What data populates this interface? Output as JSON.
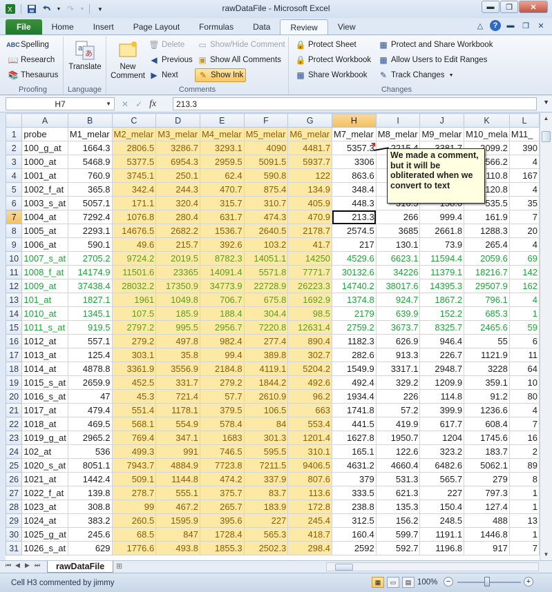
{
  "window": {
    "title": "rawDataFile - Microsoft Excel",
    "controls": [
      "minimize",
      "restore",
      "close"
    ]
  },
  "ribbon": {
    "tabs": [
      "File",
      "Home",
      "Insert",
      "Page Layout",
      "Formulas",
      "Data",
      "Review",
      "View"
    ],
    "active_tab": "Review",
    "groups": {
      "proofing": {
        "label": "Proofing",
        "spelling": "Spelling",
        "research": "Research",
        "thesaurus": "Thesaurus"
      },
      "language": {
        "label": "Language",
        "translate": "Translate"
      },
      "comments": {
        "label": "Comments",
        "new_comment": "New\nComment",
        "delete": "Delete",
        "previous": "Previous",
        "next": "Next",
        "show_hide": "Show/Hide Comment",
        "show_all": "Show All Comments",
        "show_ink": "Show Ink"
      },
      "changes": {
        "label": "Changes",
        "protect_sheet": "Protect Sheet",
        "protect_workbook": "Protect Workbook",
        "share_workbook": "Share Workbook",
        "protect_share": "Protect and Share Workbook",
        "allow_edit": "Allow Users to Edit Ranges",
        "track_changes": "Track Changes"
      }
    }
  },
  "formula_bar": {
    "name_box": "H7",
    "formula": "213.3"
  },
  "grid": {
    "columns": [
      "A",
      "B",
      "C",
      "D",
      "E",
      "F",
      "G",
      "H",
      "I",
      "J",
      "K",
      "L"
    ],
    "selected_column": "H",
    "selected_row": "7",
    "header_row": [
      "probe",
      "M1_melar",
      "M2_melar",
      "M3_melar",
      "M4_melar",
      "M5_melar",
      "M6_melar",
      "M7_melar",
      "M8_melar",
      "M9_melar",
      "M10_mela",
      "M11_"
    ],
    "rows": [
      {
        "n": "2",
        "c": [
          "100_g_at",
          "1664.3",
          "2806.5",
          "3286.7",
          "3293.1",
          "4090",
          "4481.7",
          "5357.3",
          "2215.4",
          "3381.7",
          "2099.2",
          "390"
        ]
      },
      {
        "n": "3",
        "c": [
          "1000_at",
          "5468.9",
          "5377.5",
          "6954.3",
          "2959.5",
          "5091.5",
          "5937.7",
          "3306",
          "",
          "",
          "566.2",
          "4"
        ]
      },
      {
        "n": "4",
        "c": [
          "1001_at",
          "760.9",
          "3745.1",
          "250.1",
          "62.4",
          "590.8",
          "122",
          "863.6",
          "",
          "",
          "110.8",
          "167"
        ]
      },
      {
        "n": "5",
        "c": [
          "1002_f_at",
          "365.8",
          "342.4",
          "244.3",
          "470.7",
          "875.4",
          "134.9",
          "348.4",
          "",
          "",
          "120.8",
          "4"
        ]
      },
      {
        "n": "6",
        "c": [
          "1003_s_at",
          "5057.1",
          "171.1",
          "320.4",
          "315.7",
          "310.7",
          "405.9",
          "448.3",
          "316.5",
          "158.0",
          "535.5",
          "35"
        ]
      },
      {
        "n": "7",
        "c": [
          "1004_at",
          "7292.4",
          "1076.8",
          "280.4",
          "631.7",
          "474.3",
          "470.9",
          "213.3",
          "266",
          "999.4",
          "161.9",
          "7"
        ]
      },
      {
        "n": "8",
        "c": [
          "1005_at",
          "2293.1",
          "14676.5",
          "2682.2",
          "1536.7",
          "2640.5",
          "2178.7",
          "2574.5",
          "3685",
          "2661.8",
          "1288.3",
          "20"
        ]
      },
      {
        "n": "9",
        "c": [
          "1006_at",
          "590.1",
          "49.6",
          "215.7",
          "392.6",
          "103.2",
          "41.7",
          "217",
          "130.1",
          "73.9",
          "265.4",
          "4"
        ]
      },
      {
        "n": "10",
        "g": true,
        "c": [
          "1007_s_at",
          "2705.2",
          "9724.2",
          "2019.5",
          "8782.3",
          "14051.1",
          "14250",
          "4529.6",
          "6623.1",
          "11594.4",
          "2059.6",
          "69"
        ]
      },
      {
        "n": "11",
        "g": true,
        "c": [
          "1008_f_at",
          "14174.9",
          "11501.6",
          "23365",
          "14091.4",
          "5571.8",
          "7771.7",
          "30132.6",
          "34226",
          "11379.1",
          "18216.7",
          "142"
        ]
      },
      {
        "n": "12",
        "g": true,
        "c": [
          "1009_at",
          "37438.4",
          "28032.2",
          "17350.9",
          "34773.9",
          "22728.9",
          "26223.3",
          "14740.2",
          "38017.6",
          "14395.3",
          "29507.9",
          "162"
        ]
      },
      {
        "n": "13",
        "g": true,
        "c": [
          "101_at",
          "1827.1",
          "1961",
          "1049.8",
          "706.7",
          "675.8",
          "1692.9",
          "1374.8",
          "924.7",
          "1867.2",
          "796.1",
          "4"
        ]
      },
      {
        "n": "14",
        "g": true,
        "c": [
          "1010_at",
          "1345.1",
          "107.5",
          "185.9",
          "188.4",
          "304.4",
          "98.5",
          "2179",
          "639.9",
          "152.2",
          "685.3",
          "1"
        ]
      },
      {
        "n": "15",
        "g": true,
        "c": [
          "1011_s_at",
          "919.5",
          "2797.2",
          "995.5",
          "2956.7",
          "7220.8",
          "12631.4",
          "2759.2",
          "3673.7",
          "8325.7",
          "2465.6",
          "59"
        ]
      },
      {
        "n": "16",
        "c": [
          "1012_at",
          "557.1",
          "279.2",
          "497.8",
          "982.4",
          "277.4",
          "890.4",
          "1182.3",
          "626.9",
          "946.4",
          "55",
          "6"
        ]
      },
      {
        "n": "17",
        "c": [
          "1013_at",
          "125.4",
          "303.1",
          "35.8",
          "99.4",
          "389.8",
          "302.7",
          "282.6",
          "913.3",
          "226.7",
          "1121.9",
          "11"
        ]
      },
      {
        "n": "18",
        "c": [
          "1014_at",
          "4878.8",
          "3361.9",
          "3556.9",
          "2184.8",
          "4119.1",
          "5204.2",
          "1549.9",
          "3317.1",
          "2948.7",
          "3228",
          "64"
        ]
      },
      {
        "n": "19",
        "c": [
          "1015_s_at",
          "2659.9",
          "452.5",
          "331.7",
          "279.2",
          "1844.2",
          "492.6",
          "492.4",
          "329.2",
          "1209.9",
          "359.1",
          "10"
        ]
      },
      {
        "n": "20",
        "c": [
          "1016_s_at",
          "47",
          "45.3",
          "721.4",
          "57.7",
          "2610.9",
          "96.2",
          "1934.4",
          "226",
          "114.8",
          "91.2",
          "80"
        ]
      },
      {
        "n": "21",
        "c": [
          "1017_at",
          "479.4",
          "551.4",
          "1178.1",
          "379.5",
          "106.5",
          "663",
          "1741.8",
          "57.2",
          "399.9",
          "1236.6",
          "4"
        ]
      },
      {
        "n": "22",
        "c": [
          "1018_at",
          "469.5",
          "568.1",
          "554.9",
          "578.4",
          "84",
          "553.4",
          "441.5",
          "419.9",
          "617.7",
          "608.4",
          "7"
        ]
      },
      {
        "n": "23",
        "c": [
          "1019_g_at",
          "2965.2",
          "769.4",
          "347.1",
          "1683",
          "301.3",
          "1201.4",
          "1627.8",
          "1950.7",
          "1204",
          "1745.6",
          "16"
        ]
      },
      {
        "n": "24",
        "c": [
          "102_at",
          "536",
          "499.3",
          "991",
          "746.5",
          "595.5",
          "310.1",
          "165.1",
          "122.6",
          "323.2",
          "183.7",
          "2"
        ]
      },
      {
        "n": "25",
        "c": [
          "1020_s_at",
          "8051.1",
          "7943.7",
          "4884.9",
          "7723.8",
          "7211.5",
          "9406.5",
          "4631.2",
          "4660.4",
          "6482.6",
          "5062.1",
          "89"
        ]
      },
      {
        "n": "26",
        "c": [
          "1021_at",
          "1442.4",
          "509.1",
          "1144.8",
          "474.2",
          "337.9",
          "807.6",
          "379",
          "531.3",
          "565.7",
          "279",
          "8"
        ]
      },
      {
        "n": "27",
        "c": [
          "1022_f_at",
          "139.8",
          "278.7",
          "555.1",
          "375.7",
          "83.7",
          "113.6",
          "333.5",
          "621.3",
          "227",
          "797.3",
          "1"
        ]
      },
      {
        "n": "28",
        "c": [
          "1023_at",
          "308.8",
          "99",
          "467.2",
          "265.7",
          "183.9",
          "172.8",
          "238.8",
          "135.3",
          "150.4",
          "127.4",
          "1"
        ]
      },
      {
        "n": "29",
        "c": [
          "1024_at",
          "383.2",
          "260.5",
          "1595.9",
          "395.6",
          "227",
          "245.4",
          "312.5",
          "156.2",
          "248.5",
          "488",
          "13"
        ]
      },
      {
        "n": "30",
        "c": [
          "1025_g_at",
          "245.6",
          "68.5",
          "847",
          "1728.4",
          "565.3",
          "418.7",
          "160.4",
          "599.7",
          "1191.1",
          "1446.8",
          "1"
        ]
      },
      {
        "n": "31",
        "c": [
          "1026_s_at",
          "629",
          "1776.6",
          "493.8",
          "1855.3",
          "2502.3",
          "298.4",
          "2592",
          "592.7",
          "1196.8",
          "917",
          "7"
        ]
      }
    ]
  },
  "comment": {
    "text": "We made a comment, but it will be obliterated when we convert to text"
  },
  "sheet_tabs": {
    "active": "rawDataFile"
  },
  "status": {
    "text": "Cell H3 commented by jimmy",
    "zoom": "100%"
  },
  "colors": {
    "highlight_fill": "#fce9a5",
    "green_text": "#1fa33a",
    "file_tab": "#2a7f2f"
  }
}
